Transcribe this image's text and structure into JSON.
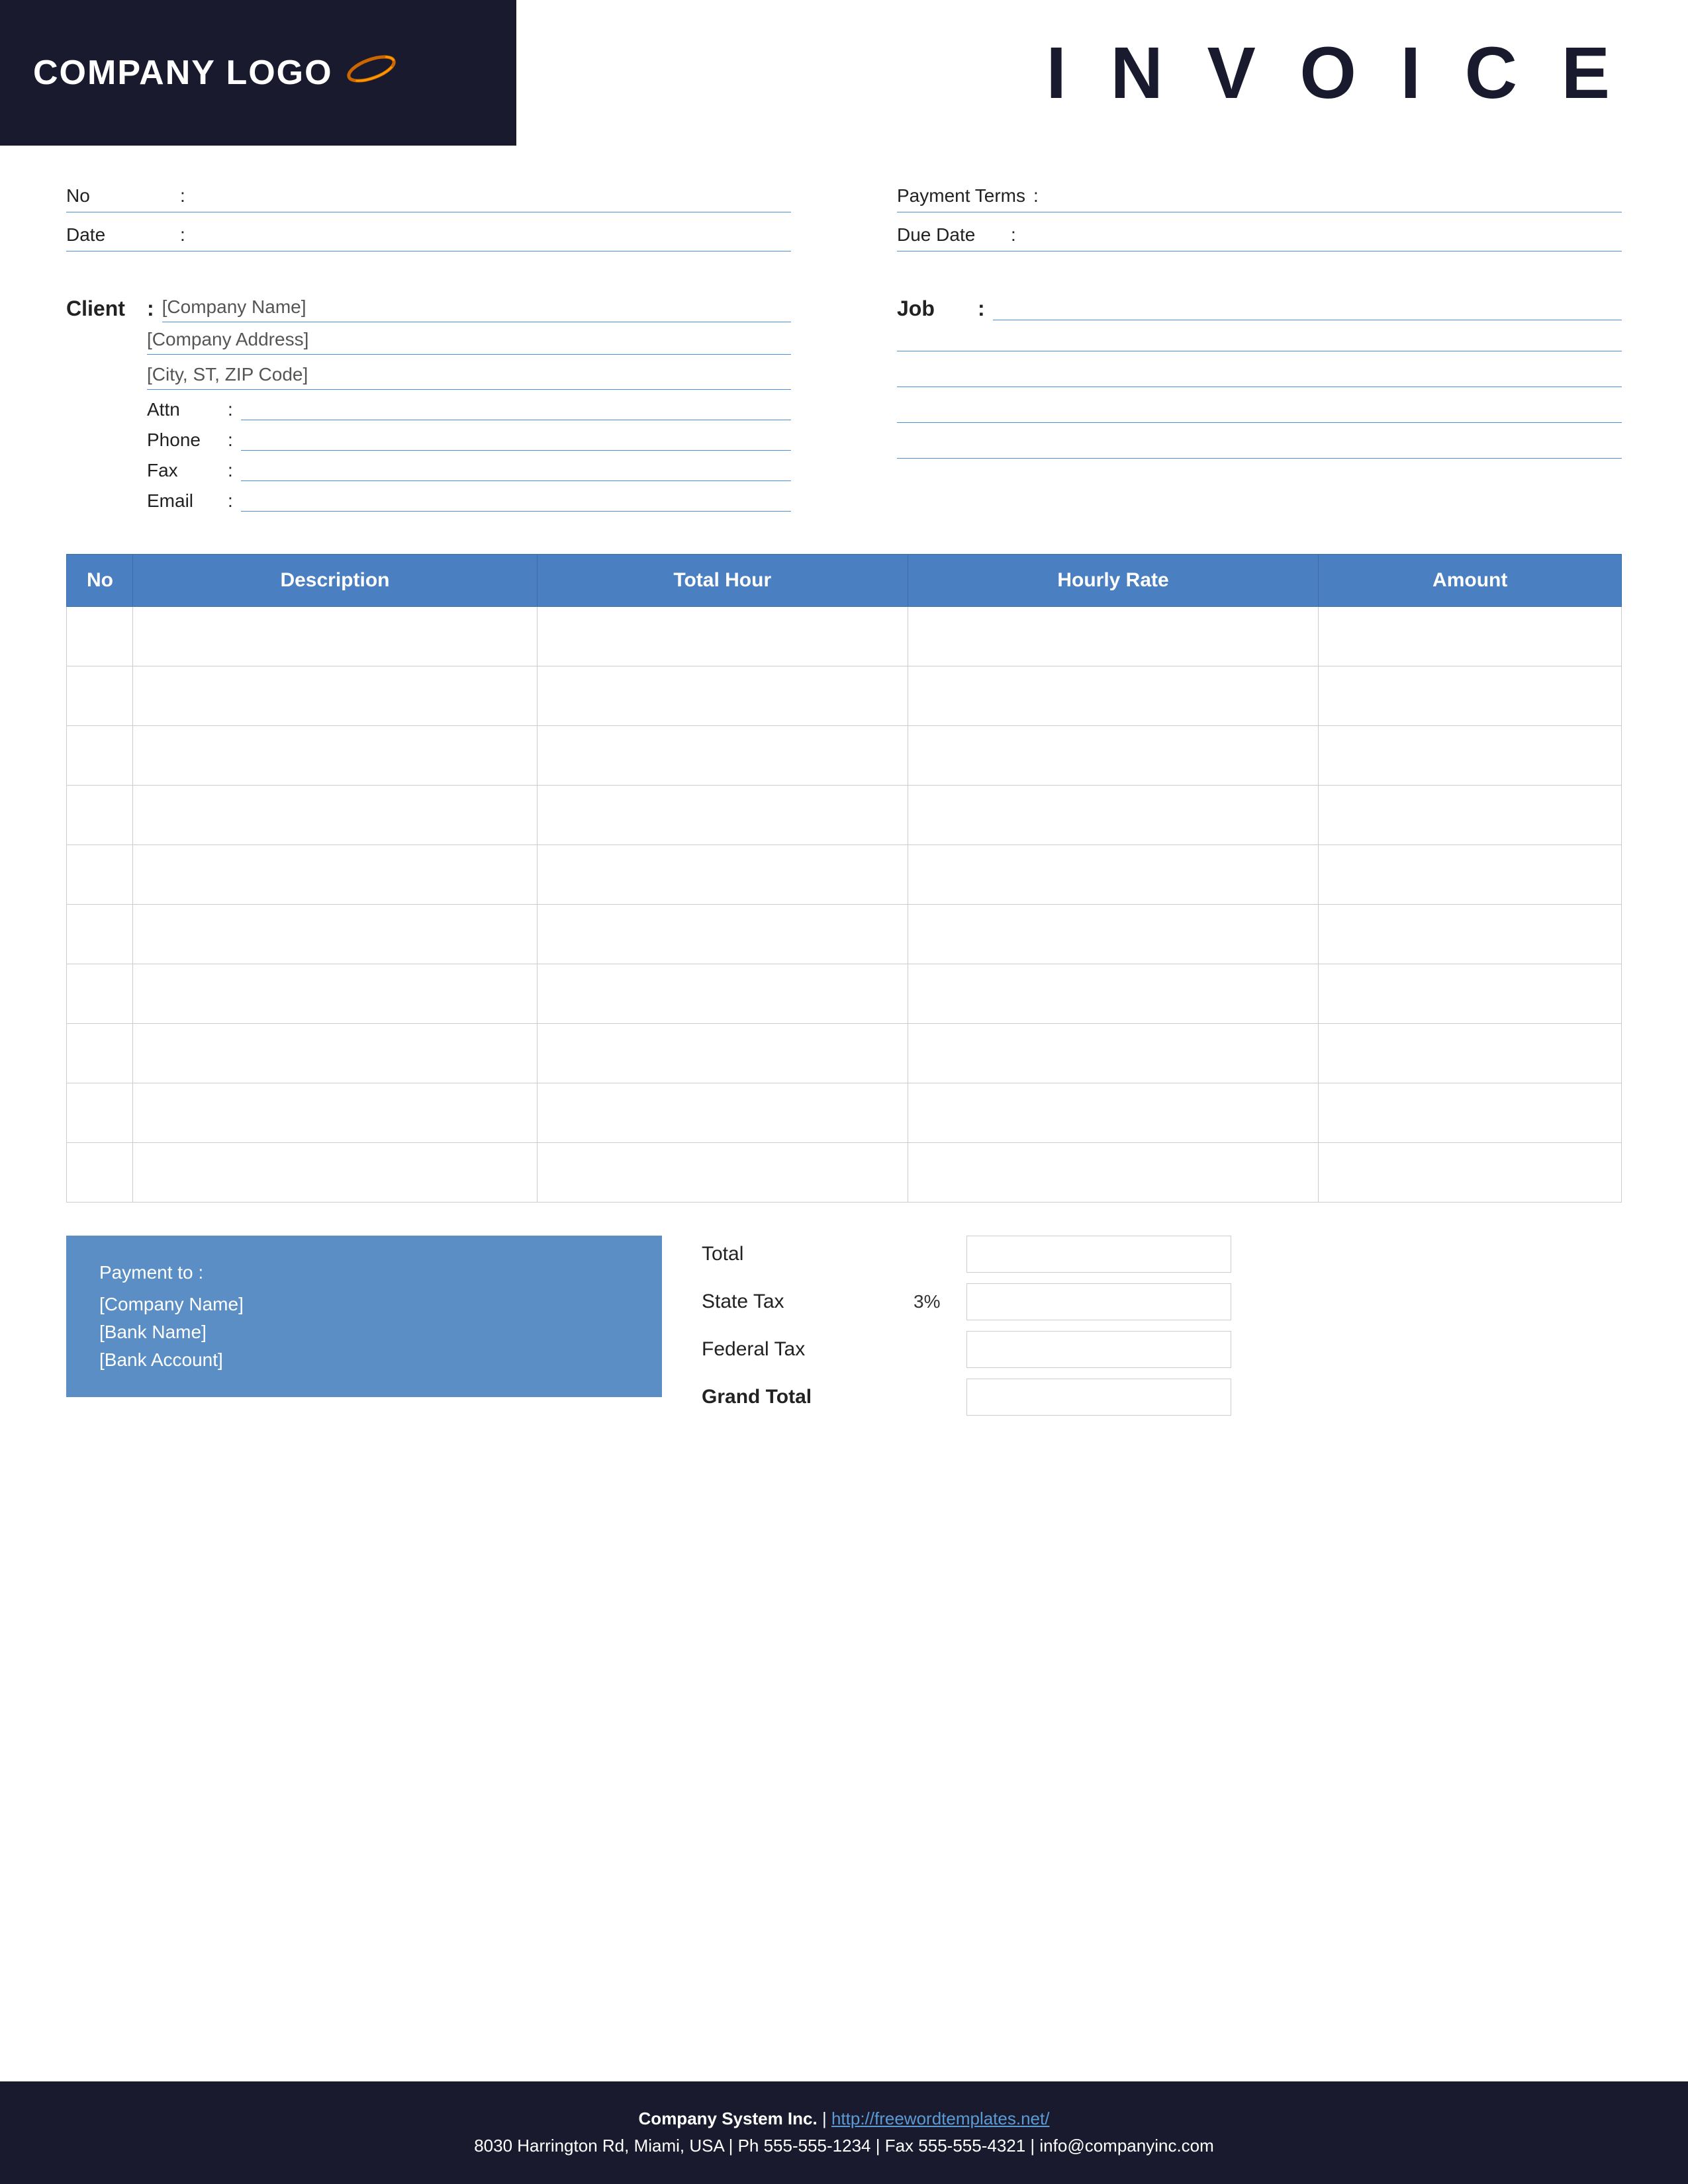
{
  "header": {
    "logo_text": "COMPANY LOGO",
    "invoice_title": "I N V O I C E"
  },
  "top_fields": {
    "left": {
      "no_label": "No",
      "no_colon": ":",
      "no_value": "",
      "date_label": "Date",
      "date_colon": ":",
      "date_value": ""
    },
    "right": {
      "payment_terms_label": "Payment  Terms",
      "payment_terms_colon": ":",
      "payment_terms_value": "",
      "due_date_label": "Due Date",
      "due_date_colon": ":",
      "due_date_value": ""
    }
  },
  "client_section": {
    "label": "Client",
    "colon": ":",
    "company_name": "[Company Name]",
    "company_address": "[Company Address]",
    "city_zip": "[City, ST, ZIP Code]",
    "attn_label": "Attn",
    "attn_colon": ":",
    "attn_value": "",
    "phone_label": "Phone",
    "phone_colon": ":",
    "phone_value": "",
    "fax_label": "Fax",
    "fax_colon": ":",
    "fax_value": "",
    "email_label": "Email",
    "email_colon": ":",
    "email_value": ""
  },
  "job_section": {
    "label": "Job",
    "colon": ":",
    "lines": [
      "",
      "",
      "",
      ""
    ]
  },
  "table": {
    "headers": [
      "No",
      "Description",
      "Total Hour",
      "Hourly Rate",
      "Amount"
    ],
    "rows": [
      [
        "",
        "",
        "",
        "",
        ""
      ],
      [
        "",
        "",
        "",
        "",
        ""
      ],
      [
        "",
        "",
        "",
        "",
        ""
      ],
      [
        "",
        "",
        "",
        "",
        ""
      ],
      [
        "",
        "",
        "",
        "",
        ""
      ],
      [
        "",
        "",
        "",
        "",
        ""
      ],
      [
        "",
        "",
        "",
        "",
        ""
      ],
      [
        "",
        "",
        "",
        "",
        ""
      ],
      [
        "",
        "",
        "",
        "",
        ""
      ],
      [
        "",
        "",
        "",
        "",
        ""
      ]
    ]
  },
  "payment": {
    "label": "Payment to :",
    "company_name": "[Company Name]",
    "bank_name": "[Bank Name]",
    "bank_account": "[Bank Account]"
  },
  "totals": {
    "total_label": "Total",
    "state_tax_label": "State Tax",
    "state_tax_percent": "3%",
    "federal_tax_label": "Federal Tax",
    "grand_total_label": "Grand Total",
    "total_value": "",
    "state_tax_value": "",
    "federal_tax_value": "",
    "grand_total_value": ""
  },
  "footer": {
    "company_bold": "Company System Inc.",
    "separator": " | ",
    "link_text": "http://freewordtemplates.net/",
    "address_line": "8030 Harrington Rd, Miami, USA | Ph 555-555-1234 | Fax 555-555-4321 | info@companyinc.com"
  }
}
